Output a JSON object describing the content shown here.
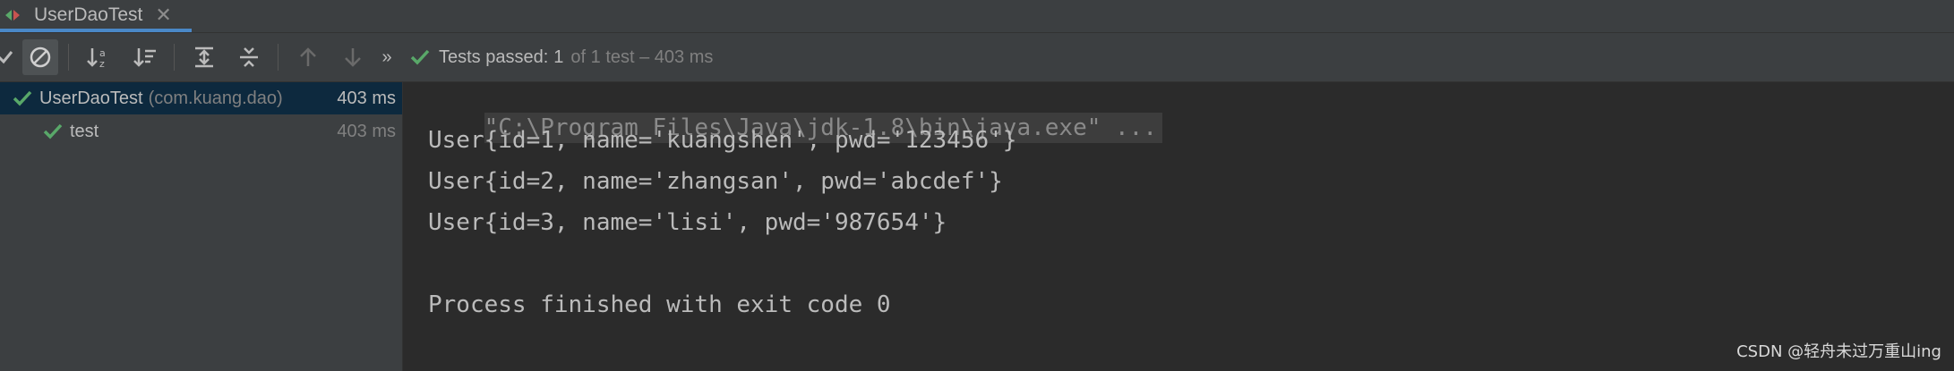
{
  "tab": {
    "title": "UserDaoTest",
    "close_glyph": "✕"
  },
  "toolbar": {
    "status_passed": "Tests passed:",
    "status_count": "1",
    "status_detail": "of 1 test – 403 ms",
    "overflow": "»",
    "colors": {
      "pass": "#59a869"
    }
  },
  "tree": {
    "items": [
      {
        "name": "UserDaoTest",
        "package": "(com.kuang.dao)",
        "time": "403 ms"
      },
      {
        "name": "test",
        "time": "403 ms"
      }
    ]
  },
  "console": {
    "command": "\"C:\\Program Files\\Java\\jdk-1.8\\bin\\java.exe\" ...",
    "lines": [
      "User{id=1, name='kuangshen', pwd='123456'}",
      "User{id=2, name='zhangsan', pwd='abcdef'}",
      "User{id=3, name='lisi', pwd='987654'}"
    ],
    "exit": "Process finished with exit code 0"
  },
  "watermark": "CSDN @轻舟未过万重山ing"
}
